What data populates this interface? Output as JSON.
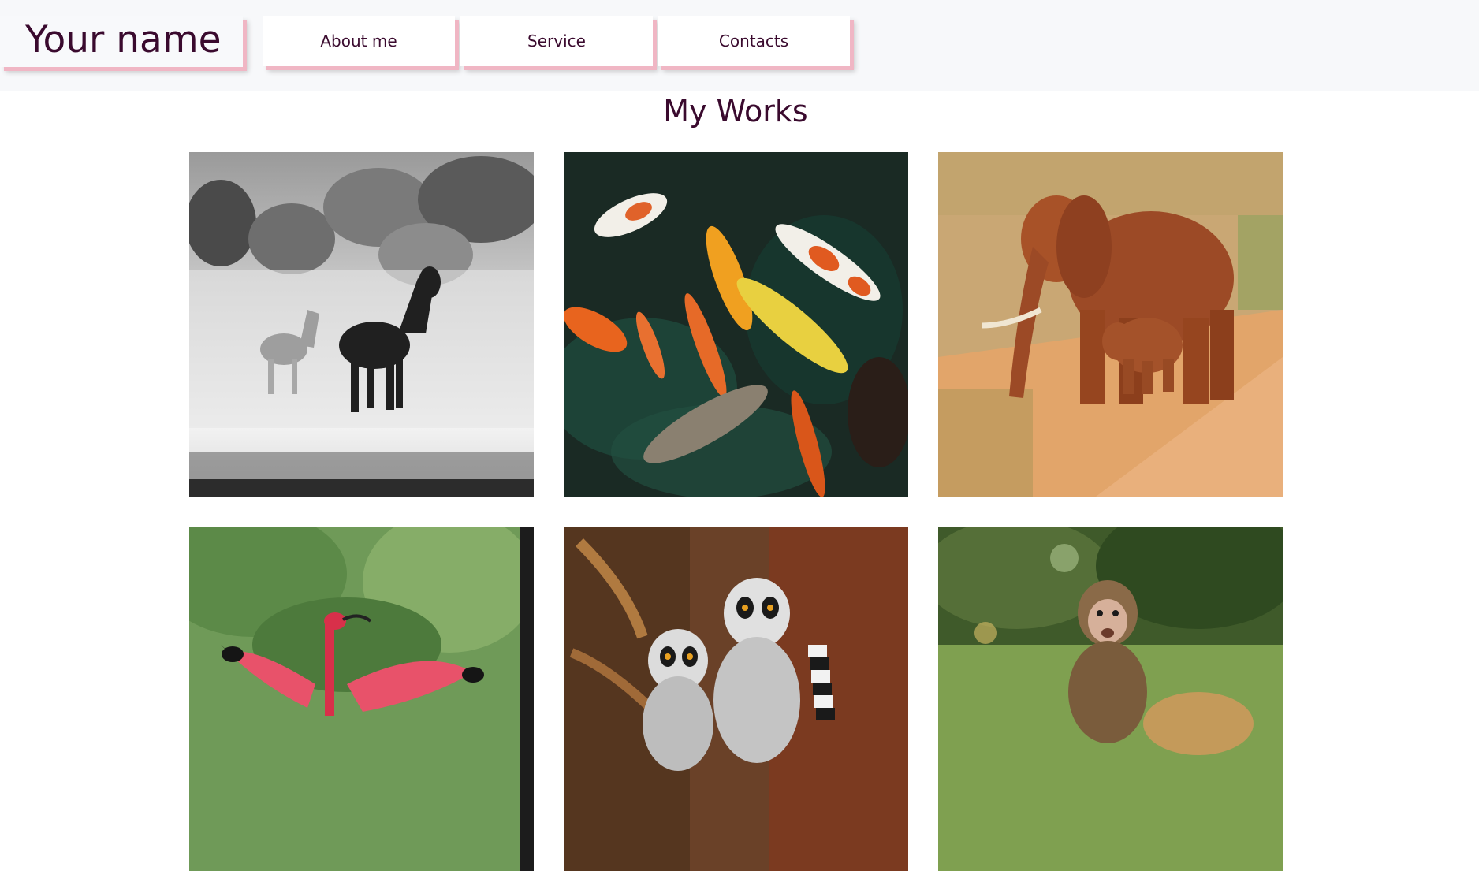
{
  "header": {
    "brand": "Your name",
    "nav": [
      {
        "label": "About me"
      },
      {
        "label": "Service"
      },
      {
        "label": "Contacts"
      }
    ]
  },
  "works": {
    "title": "My Works",
    "items": [
      {
        "subject": "horses-photo"
      },
      {
        "subject": "koi-fish-photo"
      },
      {
        "subject": "elephants-photo"
      },
      {
        "subject": "scarlet-ibis-photo"
      },
      {
        "subject": "lemurs-photo"
      },
      {
        "subject": "baby-monkey-photo"
      }
    ]
  },
  "colors": {
    "text": "#3a0a2e",
    "accent_shadow": "#f0b6c4",
    "header_bg": "#f7f8fa"
  }
}
